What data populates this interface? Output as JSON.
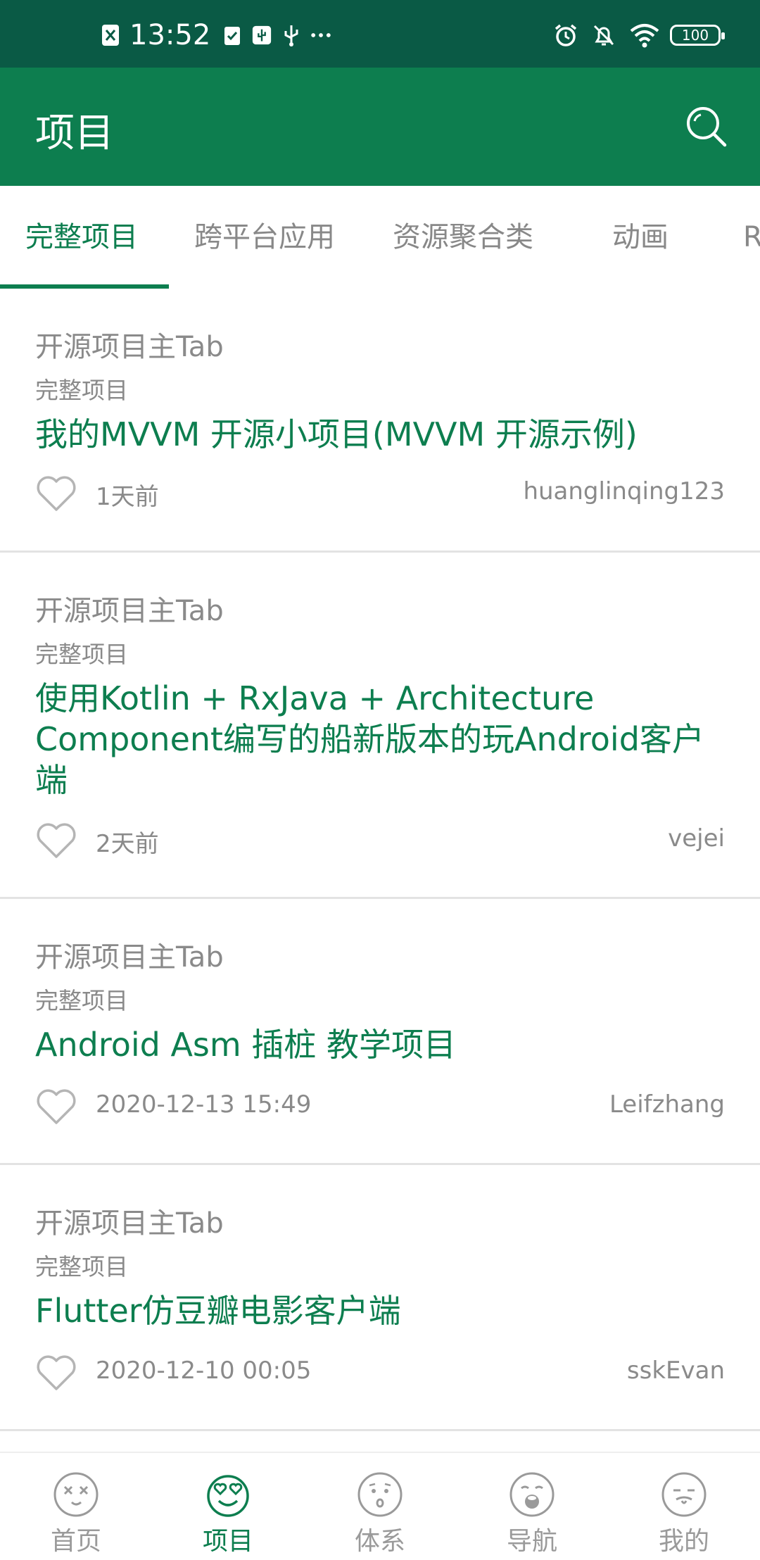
{
  "status_bar": {
    "time": "13:52",
    "battery": "100",
    "left_icons": [
      "sim-card-x-icon",
      "clipboard-check-icon",
      "usb-debug-icon",
      "usb-icon",
      "more-dots-icon"
    ],
    "right_icons": [
      "alarm-icon",
      "bell-off-icon",
      "wifi-icon",
      "battery-icon"
    ]
  },
  "app_bar": {
    "title": "项目",
    "search_icon": "search-icon"
  },
  "tabs": [
    {
      "label": "完整项目",
      "active": true
    },
    {
      "label": "跨平台应用",
      "active": false
    },
    {
      "label": "资源聚合类",
      "active": false
    },
    {
      "label": "动画",
      "active": false
    },
    {
      "label": "R",
      "active": false
    }
  ],
  "articles": [
    {
      "chapter": "开源项目主Tab",
      "super_chapter": "完整项目",
      "title": "我的MVVM 开源小项目(MVVM 开源示例)",
      "date": "1天前",
      "author": "huanglinqing123"
    },
    {
      "chapter": "开源项目主Tab",
      "super_chapter": "完整项目",
      "title": "使用Kotlin + RxJava + Architecture Component编写的船新版本的玩Android客户端",
      "date": "2天前",
      "author": "vejei"
    },
    {
      "chapter": "开源项目主Tab",
      "super_chapter": "完整项目",
      "title": "Android Asm 插桩 教学项目",
      "date": "2020-12-13 15:49",
      "author": "Leifzhang"
    },
    {
      "chapter": "开源项目主Tab",
      "super_chapter": "完整项目",
      "title": "Flutter仿豆瓣电影客户端",
      "date": "2020-12-10 00:05",
      "author": "sskEvan"
    }
  ],
  "bottom_nav": [
    {
      "label": "首页",
      "icon": "face-dizzy-icon",
      "active": false
    },
    {
      "label": "项目",
      "icon": "face-love-icon",
      "active": true
    },
    {
      "label": "体系",
      "icon": "face-surprised-icon",
      "active": false
    },
    {
      "label": "导航",
      "icon": "face-open-mouth-icon",
      "active": false
    },
    {
      "label": "我的",
      "icon": "face-smirk-icon",
      "active": false
    }
  ],
  "colors": {
    "status_bar": "#0a5a45",
    "primary": "#0d7e4f",
    "text_secondary": "#8a8a8a",
    "divider": "#e3e3e3"
  }
}
